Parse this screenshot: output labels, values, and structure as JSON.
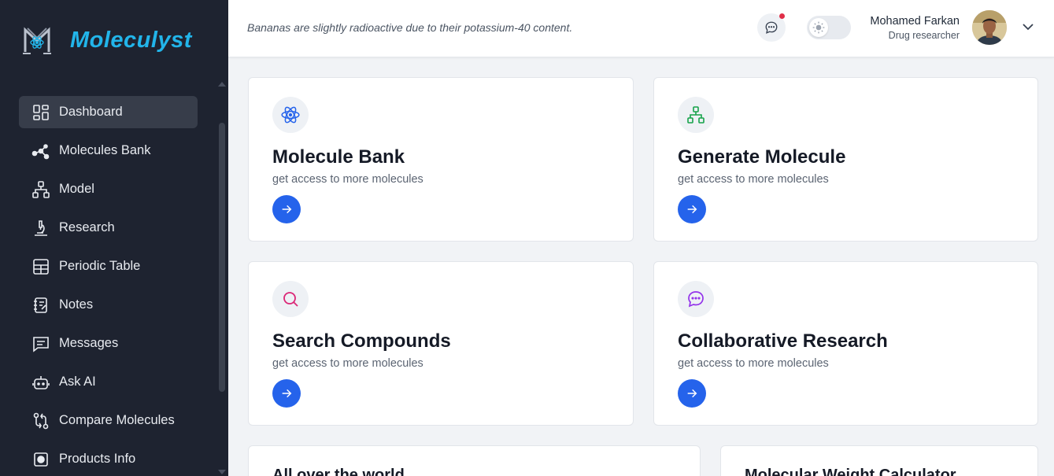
{
  "app": {
    "name": "Moleculyst"
  },
  "sidebar": {
    "items": [
      {
        "label": "Dashboard",
        "icon": "dashboard-icon",
        "active": true
      },
      {
        "label": "Molecules Bank",
        "icon": "molecule-icon"
      },
      {
        "label": "Model",
        "icon": "hierarchy-icon"
      },
      {
        "label": "Research",
        "icon": "microscope-icon"
      },
      {
        "label": "Periodic Table",
        "icon": "table-icon"
      },
      {
        "label": "Notes",
        "icon": "notebook-icon"
      },
      {
        "label": "Messages",
        "icon": "chat-icon"
      },
      {
        "label": "Ask AI",
        "icon": "robot-icon"
      },
      {
        "label": "Compare Molecules",
        "icon": "compare-icon"
      },
      {
        "label": "Products Info",
        "icon": "box-icon"
      }
    ]
  },
  "header": {
    "fact": "Bananas are slightly radioactive due to their potassium-40 content.",
    "user": {
      "name": "Mohamed Farkan",
      "role": "Drug researcher"
    }
  },
  "cards": [
    {
      "title": "Molecule Bank",
      "subtitle": "get access to more molecules",
      "icon": "atom-icon",
      "color": "#2563eb"
    },
    {
      "title": "Generate Molecule",
      "subtitle": "get access to more molecules",
      "icon": "hierarchy-icon",
      "color": "#16a34a"
    },
    {
      "title": "Search Compounds",
      "subtitle": "get access to more molecules",
      "icon": "search-icon",
      "color": "#db2777"
    },
    {
      "title": "Collaborative Research",
      "subtitle": "get access to more molecules",
      "icon": "chat-icon",
      "color": "#9333ea"
    }
  ],
  "bottom_cards": [
    {
      "title": "All over the world"
    },
    {
      "title": "Molecular Weight Calculator"
    }
  ],
  "colors": {
    "accent": "#2563eb",
    "sidebar_bg": "#1e2330",
    "logo": "#22b5ea",
    "notification": "#e02e48"
  }
}
